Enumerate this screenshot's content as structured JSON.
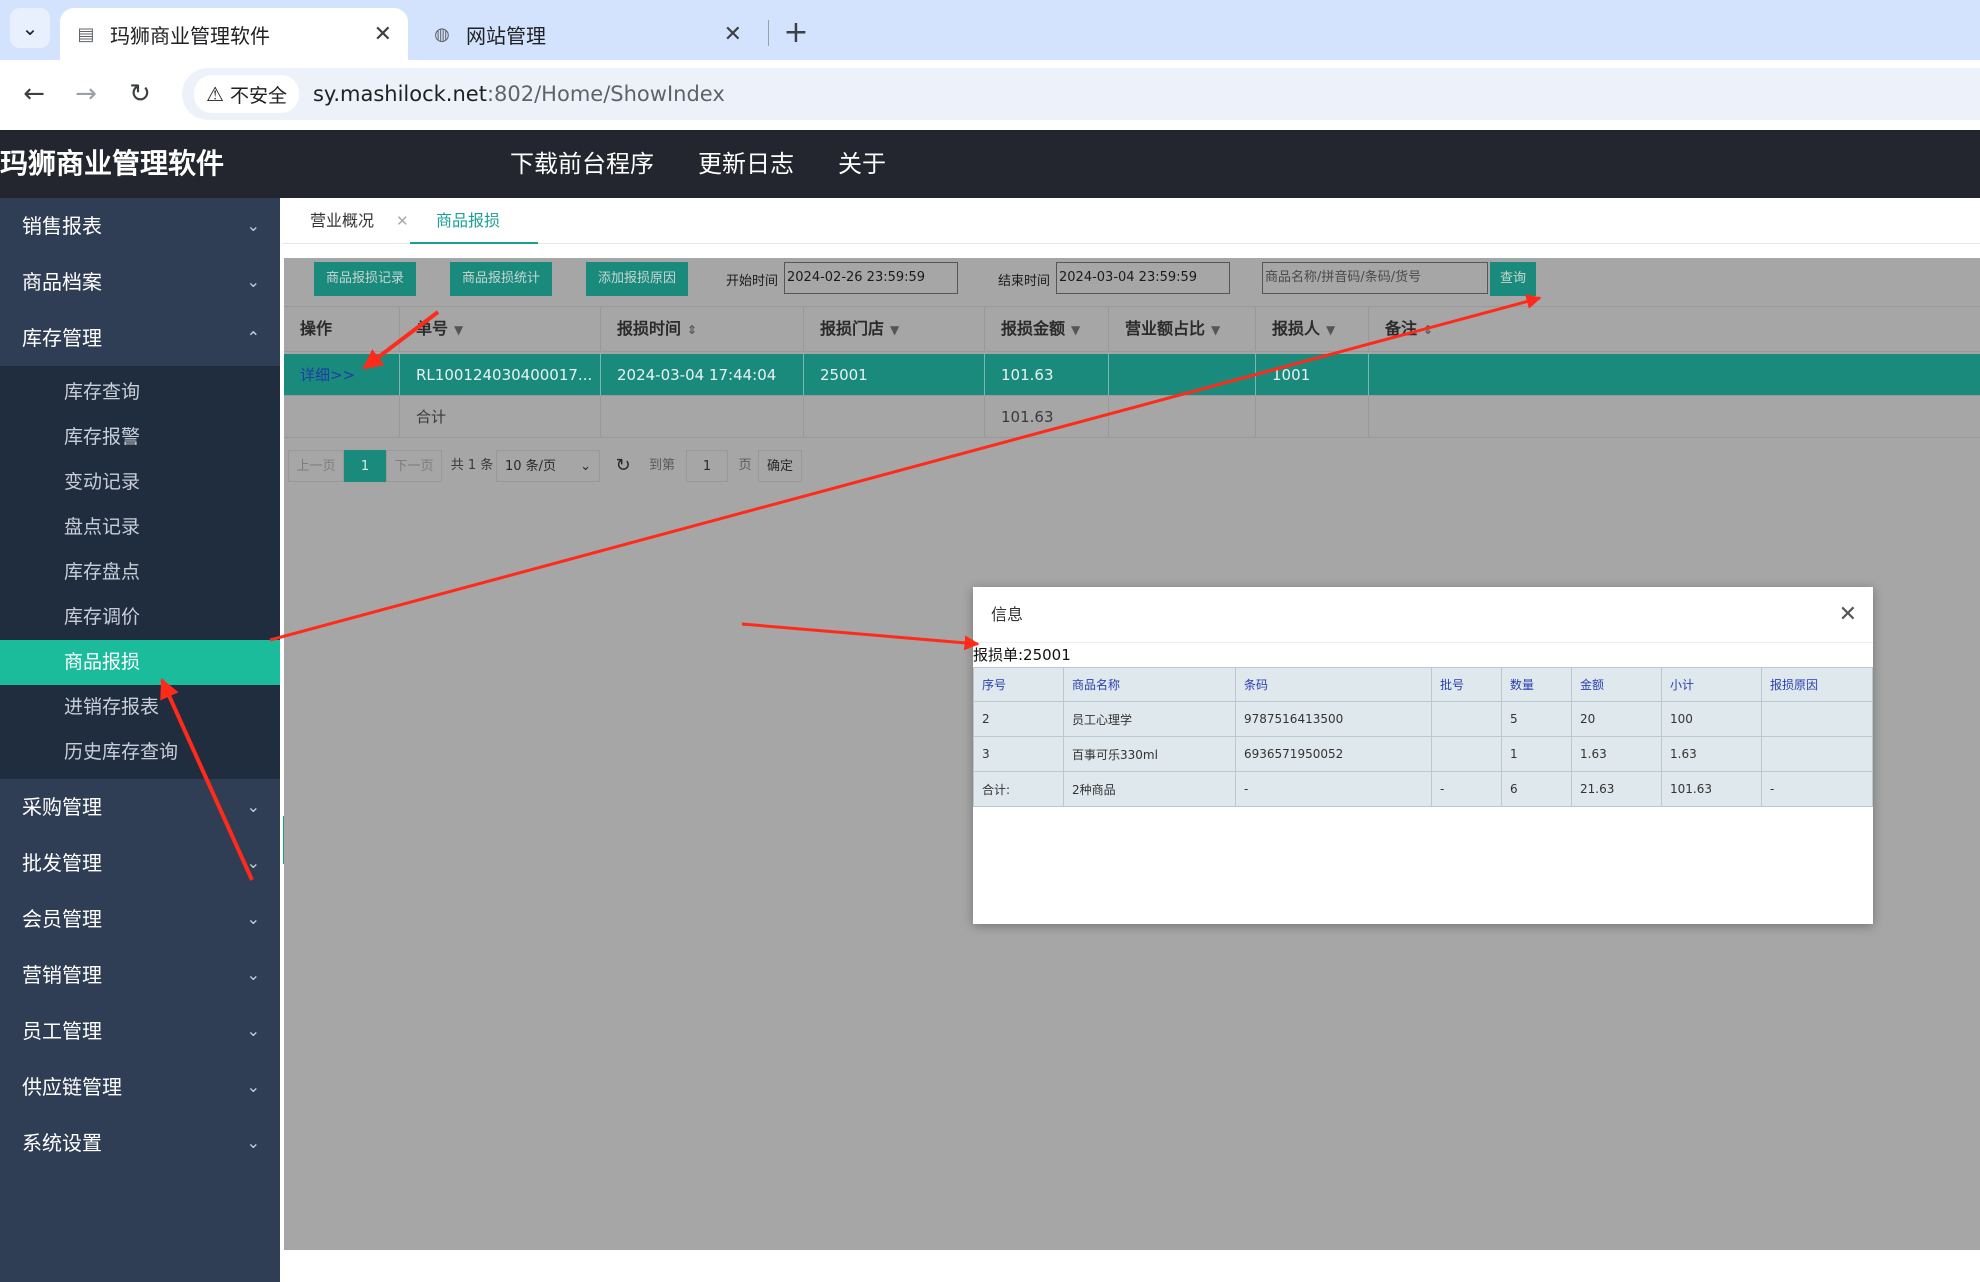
{
  "browser": {
    "tabs": [
      {
        "title": "玛狮商业管理软件",
        "close": "✕"
      },
      {
        "title": "网站管理",
        "close": "✕"
      }
    ],
    "new_tab": "+",
    "security_label": "不安全",
    "url_host": "sy.mashilock.net",
    "url_path": ":802/Home/ShowIndex"
  },
  "app": {
    "title": "玛狮商业管理软件",
    "top_nav": [
      "下载前台程序",
      "更新日志",
      "关于"
    ]
  },
  "sidebar": {
    "groups_before": [
      {
        "label": "销售报表",
        "chev": "⌄"
      },
      {
        "label": "商品档案",
        "chev": "⌄"
      }
    ],
    "open_group": {
      "label": "库存管理",
      "chev": "⌃"
    },
    "sub_items": [
      "库存查询",
      "库存报警",
      "变动记录",
      "盘点记录",
      "库存盘点",
      "库存调价",
      "商品报损",
      "进销存报表",
      "历史库存查询"
    ],
    "active_sub": "商品报损",
    "groups_after": [
      {
        "label": "采购管理",
        "chev": "⌄"
      },
      {
        "label": "批发管理",
        "chev": "⌄"
      },
      {
        "label": "会员管理",
        "chev": "⌄"
      },
      {
        "label": "营销管理",
        "chev": "⌄"
      },
      {
        "label": "员工管理",
        "chev": "⌄"
      },
      {
        "label": "供应链管理",
        "chev": "⌄"
      },
      {
        "label": "系统设置",
        "chev": "⌄"
      }
    ]
  },
  "content_tabs": [
    {
      "label": "营业概况",
      "close": "✕"
    },
    {
      "label": "商品报损",
      "close": "✕"
    }
  ],
  "toolbar": {
    "btn_records": "商品报损记录",
    "btn_stats": "商品报损统计",
    "btn_add_reason": "添加报损原因",
    "start_label": "开始时间",
    "start_value": "2024-02-26 23:59:59",
    "end_label": "结束时间",
    "end_value": "2024-03-04 23:59:59",
    "search_placeholder": "商品名称/拼音码/条码/货号",
    "btn_query": "查询"
  },
  "table": {
    "headers": [
      "操作",
      "单号",
      "报损时间",
      "报损门店",
      "报损金额",
      "营业额占比",
      "报损人",
      "备注"
    ],
    "row": {
      "action": "详细>>",
      "order_no": "RL100124030400017...",
      "time": "2024-03-04 17:44:04",
      "store": "25001",
      "amount": "101.63",
      "ratio": "",
      "person": "1001",
      "note": ""
    },
    "summary": {
      "label": "合计",
      "amount": "101.63"
    }
  },
  "pager": {
    "prev": "上一页",
    "current": "1",
    "next": "下一页",
    "total": "共 1 条",
    "page_size": "10 条/页",
    "goto_label": "到第",
    "goto_value": "1",
    "page_unit": "页",
    "confirm": "确定"
  },
  "modal": {
    "title": "信息",
    "close": "✕",
    "subtitle": "报损单:25001",
    "headers": [
      "序号",
      "商品名称",
      "条码",
      "批号",
      "数量",
      "金额",
      "小计",
      "报损原因"
    ],
    "rows": [
      [
        "2",
        "员工心理学",
        "9787516413500",
        "",
        "5",
        "20",
        "100",
        ""
      ],
      [
        "3",
        "百事可乐330ml",
        "6936571950052",
        "",
        "1",
        "1.63",
        "1.63",
        ""
      ],
      [
        "合计:",
        "2种商品",
        "-",
        "-",
        "6",
        "21.63",
        "101.63",
        "-"
      ]
    ]
  },
  "colors": {
    "accent": "#1aa093",
    "header_bg": "#23262e",
    "sidebar_bg": "#2f3e55",
    "arrow": "#ff2a1a"
  }
}
